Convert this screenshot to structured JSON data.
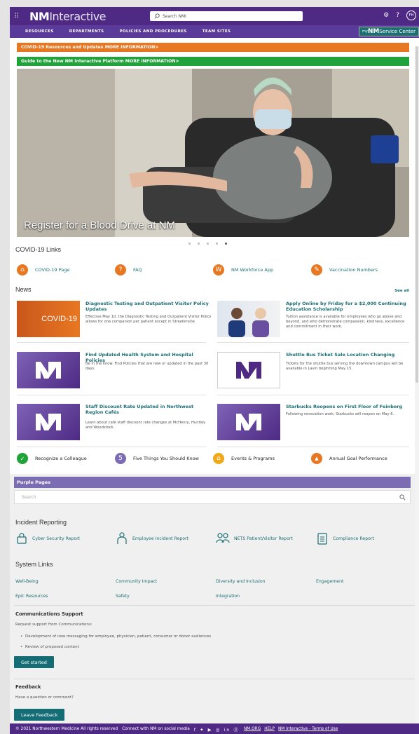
{
  "topbar": {
    "logo_mark": "NM",
    "logo_text": "Interactive",
    "search_placeholder": "Search NMI",
    "settings_glyph": "⚙",
    "help_glyph": "?",
    "avatar": "FH"
  },
  "nav": [
    "RESOURCES",
    "DEPARTMENTS",
    "POLICIES AND PROCEDURES",
    "TEAM SITES"
  ],
  "service_center": {
    "prefix": "my",
    "mark": "NM",
    "label": "Service Center"
  },
  "banners": [
    {
      "text": "COVID-19 Resources and Updates MORE INFORMATION>",
      "color": "#e87722"
    },
    {
      "text": "Guide to the New NM Interactive Platform MORE INFORMATION>",
      "color": "#20a33a"
    }
  ],
  "hero": {
    "title": "Register for a Blood Drive at NM",
    "slides": 5,
    "active": 5
  },
  "covid": {
    "heading": "COVID-19 Links",
    "links": [
      {
        "label": "COVID-19 Page",
        "icon": "home-icon"
      },
      {
        "label": "FAQ",
        "icon": "question-icon"
      },
      {
        "label": "NM Workforce App",
        "icon": "w-app-icon"
      },
      {
        "label": "Vaccination Numbers",
        "icon": "syringe-icon"
      }
    ]
  },
  "news": {
    "heading": "News",
    "see_all": "See all",
    "items": [
      {
        "title": "Diagnostic Testing and Outpatient Visitor Policy Updates",
        "desc": "Effective May 10, the Diagnostic Testing and Outpatient Visitor Policy allows for one companion per patient except in Streeterville.",
        "thumb_text": "COVID-19"
      },
      {
        "title": "Apply Online by Friday for a $2,000 Continuing Education Scholarship",
        "desc": "Tuition assistance is available for employees who go above and beyond, and who demonstrate compassion, kindness, excellence and commitment in their work."
      },
      {
        "title": "Find Updated Health System and Hospital Policies",
        "desc": "Be in the know. Find Policies that are new or updated in the past 30 days."
      },
      {
        "title": "Shuttle Bus Ticket Sale Location Changing",
        "desc": "Tickets for the shuttle bus serving the downtown campus will be available in Lavin beginning May 15."
      },
      {
        "title": "Staff Discount Rate Updated in Northwest Region Cafés",
        "desc": "Learn about café staff discount rate changes at McHenry, Huntley and Woodstock."
      },
      {
        "title": "Starbucks Reopens on First Floor of Feinberg",
        "desc": "Following renovation work, Starbucks will reopen on May 6."
      }
    ]
  },
  "quick": [
    {
      "label": "Recognize a Colleague",
      "color": "#20a33a",
      "glyph": "👍"
    },
    {
      "label": "Five Things You Should Know",
      "color": "#7b6cb3",
      "glyph": "5"
    },
    {
      "label": "Events & Programs",
      "color": "#f0a81c",
      "glyph": "⌂"
    },
    {
      "label": "Annual Goal Performance",
      "color": "#e87722",
      "glyph": "▲"
    }
  ],
  "purple_pages": {
    "heading": "Purple Pages",
    "placeholder": "Search"
  },
  "incident": {
    "heading": "Incident Reporting",
    "links": [
      "Cyber Security Report",
      "Employee Incident Report",
      "NETS Patient/Visitor Report",
      "Compliance Report"
    ]
  },
  "system": {
    "heading": "System Links",
    "links": [
      "Well-Being",
      "Community Impact",
      "Diversity and Inclusion",
      "Engagement",
      "Epic Resources",
      "Safety",
      "Integration"
    ]
  },
  "comms": {
    "heading": "Communications Support",
    "intro": "Request support from Communications:",
    "bullets": [
      "Development of new messaging for employee, physician, patient, consumer or donor audiences",
      "Review of proposed content"
    ],
    "button": "Get started"
  },
  "feedback": {
    "heading": "Feedback",
    "intro": "Have a question or comment?",
    "button": "Leave Feedback"
  },
  "footer": {
    "copyright": "© 2021 Northwestern Medicine All rights reserved",
    "social": "Connect with NM on social media",
    "social_icons": "f ✦ ▶ ◎ in ⓟ",
    "links": [
      "NM.ORG",
      "HELP",
      "NM Interactive - Terms of Use"
    ]
  }
}
